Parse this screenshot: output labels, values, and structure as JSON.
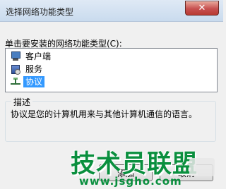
{
  "window": {
    "title": "选择网络功能类型",
    "close_symbol": "✕"
  },
  "prompt": "单击要安装的网络功能类型(C):",
  "list": {
    "items": [
      {
        "label": "客户端",
        "icon": "client-icon",
        "selected": false
      },
      {
        "label": "服务",
        "icon": "service-icon",
        "selected": false
      },
      {
        "label": "协议",
        "icon": "protocol-icon",
        "selected": true
      }
    ]
  },
  "description": {
    "title": "描述",
    "text": "协议是您的计算机用来与其他计算机通信的语言。"
  },
  "buttons": {
    "add": "添加",
    "cancel": "取消"
  },
  "watermark": {
    "text": "技术员联盟",
    "url": "www.jsgho.com"
  },
  "colors": {
    "selection": "#3399ff",
    "close_button": "#c75050",
    "watermark": "#0a8f3e"
  }
}
